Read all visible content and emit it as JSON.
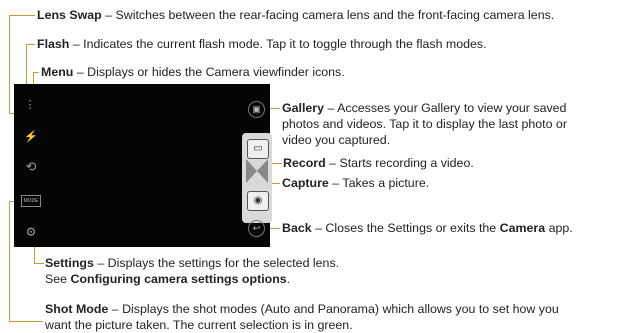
{
  "annotations": {
    "lens_swap": {
      "term": "Lens Swap",
      "desc": " – Switches between the rear-facing camera lens and the front-facing camera lens."
    },
    "flash": {
      "term": "Flash",
      "desc": " – Indicates the current flash mode. Tap it to toggle through the flash modes."
    },
    "menu": {
      "term": "Menu",
      "desc": " – Displays or hides the Camera viewfinder icons."
    },
    "gallery": {
      "term": "Gallery",
      "desc1": " – Accesses your Gallery to view your saved",
      "desc2": "photos and videos. Tap it to display the last photo or",
      "desc3": "video you captured."
    },
    "record": {
      "term": "Record",
      "desc": " – Starts recording a video."
    },
    "capture": {
      "term": "Capture",
      "desc": " – Takes a picture."
    },
    "back": {
      "term": "Back",
      "desc": " – Closes the Settings or exits the ",
      "app": "Camera",
      "tail": " app."
    },
    "settings": {
      "term": "Settings",
      "desc": " – Displays the settings for the selected lens.",
      "see": "See ",
      "link": "Configuring camera settings options",
      "end": "."
    },
    "shot_mode": {
      "term": "Shot Mode",
      "desc1": " – Displays the shot modes (Auto and Panorama) which allows you to set how you",
      "desc2": "want the picture taken. The current selection is in green."
    }
  },
  "viewfinder": {
    "menu_icon": "⋮",
    "flash_icon": "⚡",
    "lens_icon": "⟲",
    "mode_label": "MODE",
    "settings_icon": "⚙",
    "gallery_icon": "▣",
    "record_icon": "▭",
    "capture_icon": "◉",
    "back_icon": "↩"
  },
  "colors": {
    "leader": "#c89a3c",
    "screen": "#050505",
    "capture_bar": "#d9d9d9"
  }
}
